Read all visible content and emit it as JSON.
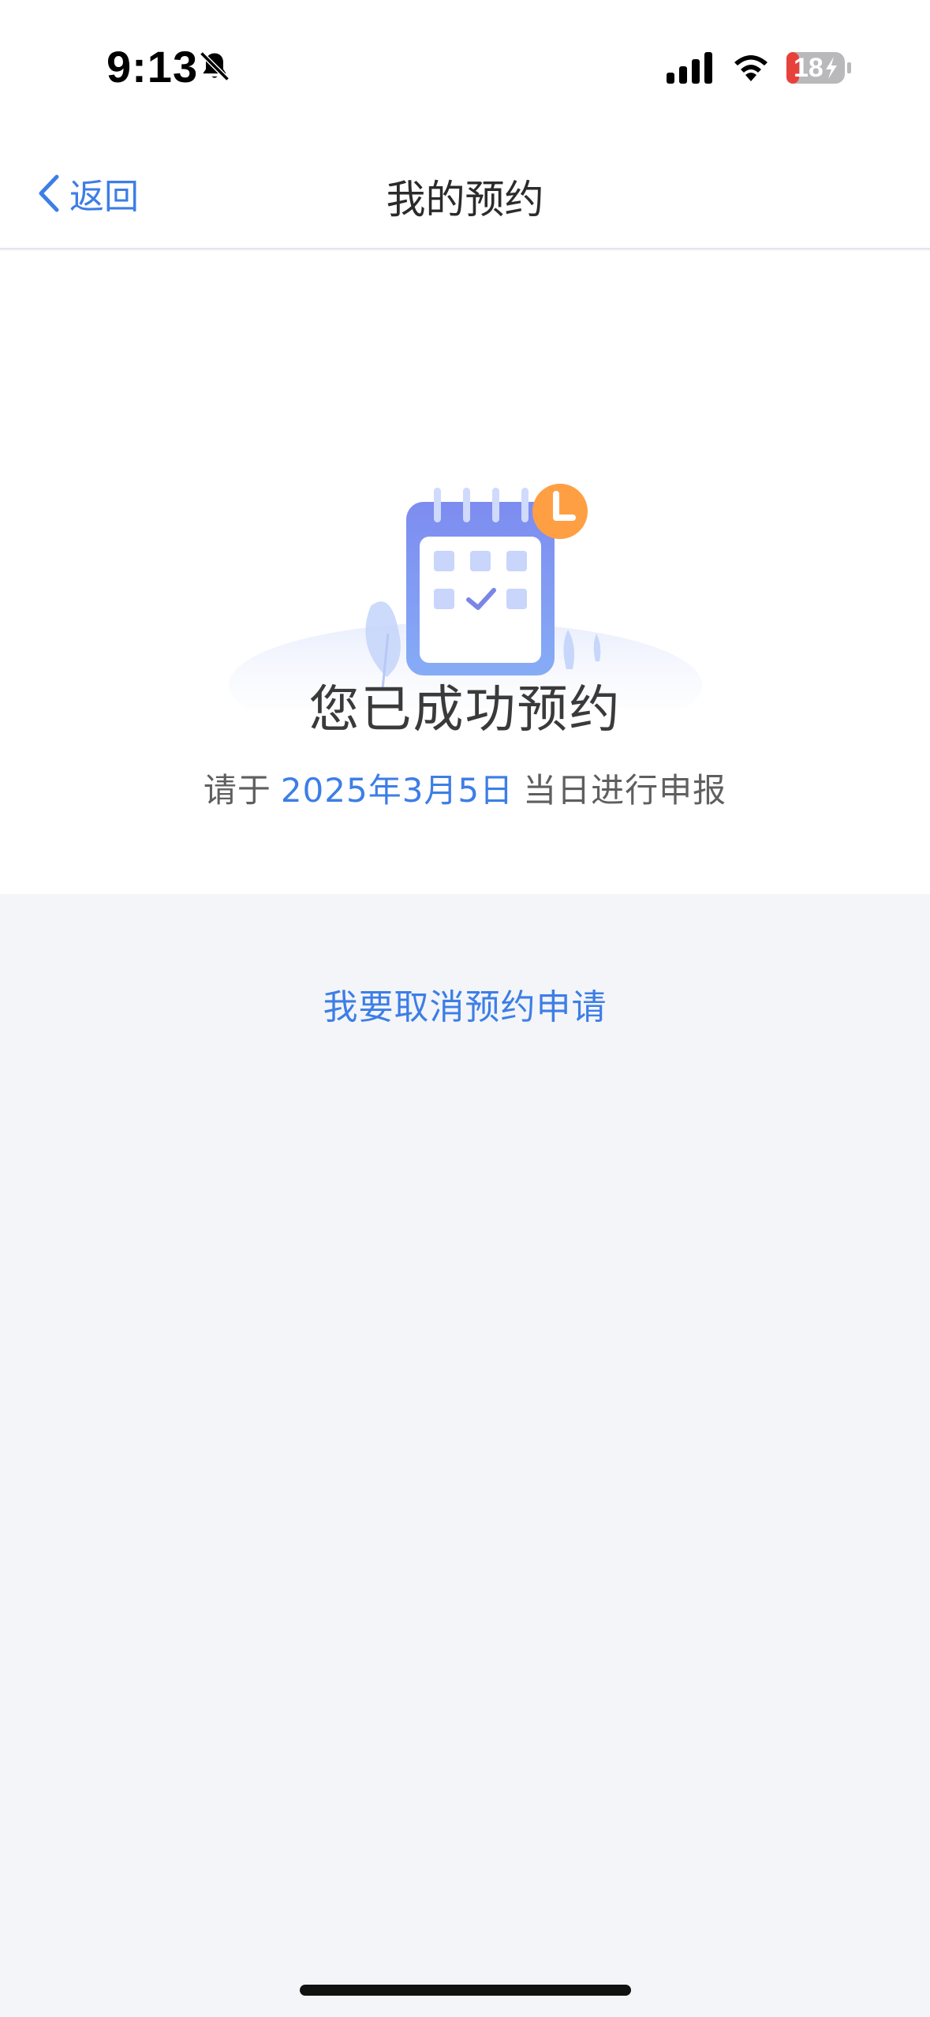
{
  "status_bar": {
    "time": "9:13",
    "battery_level": "18",
    "icons": [
      "bell-muted-icon",
      "cellular-signal-icon",
      "wifi-icon",
      "battery-charging-icon"
    ]
  },
  "nav": {
    "back_label": "返回",
    "title": "我的预约"
  },
  "content": {
    "title": "您已成功预约",
    "subtitle_prefix": "请于",
    "date": "2025年3月5日",
    "subtitle_suffix": "当日进行申报"
  },
  "actions": {
    "cancel_label": "我要取消预约申请"
  },
  "colors": {
    "accent": "#3d7ee6",
    "background": "#f3f5f9",
    "card": "#ffffff",
    "calendar": "#7f9cf0",
    "clock_badge": "#ff9f43"
  }
}
